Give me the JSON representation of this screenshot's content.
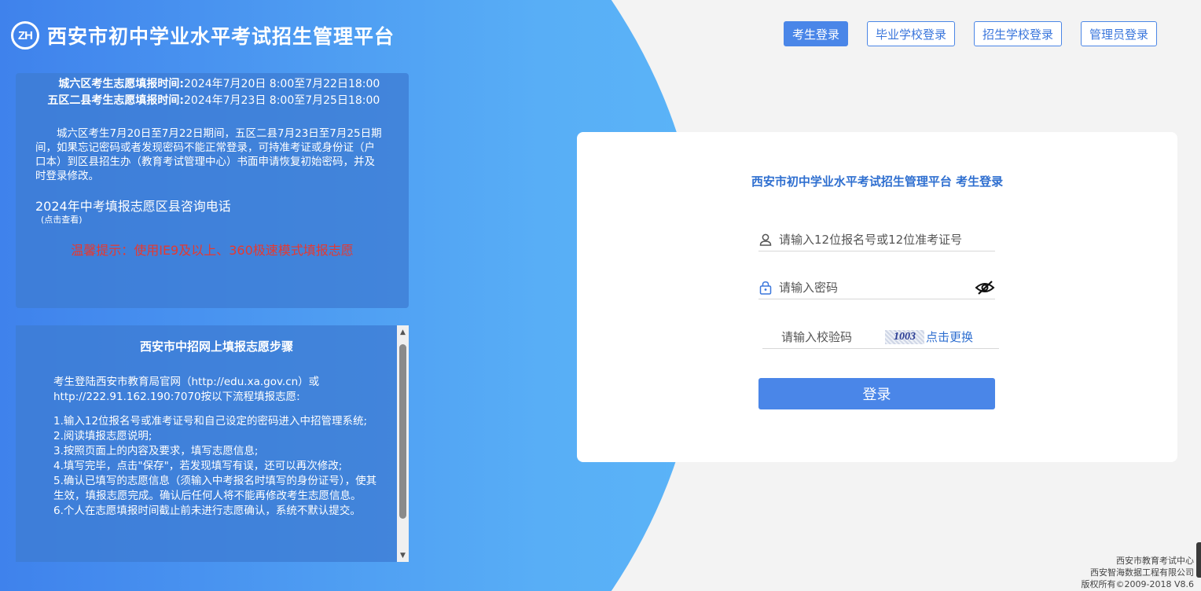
{
  "header": {
    "logo_text": "ZH",
    "title": "西安市初中学业水平考试招生管理平台"
  },
  "nav": {
    "items": [
      {
        "label": "考生登录",
        "active": true
      },
      {
        "label": "毕业学校登录"
      },
      {
        "label": "招生学校登录"
      },
      {
        "label": "管理员登录"
      }
    ]
  },
  "notice": {
    "times": [
      {
        "label": "城六区考生志愿填报时间:",
        "value": "2024年7月20日 8:00至7月22日18:00"
      },
      {
        "label": "五区二县考生志愿填报时间:",
        "value": "2024年7月23日 8:00至7月25日18:00"
      }
    ],
    "paragraph": "城六区考生7月20日至7月22日期间，五区二县7月23日至7月25日期间，如果忘记密码或者发现密码不能正常登录，可持准考证或身份证（户口本）到区县招生办（教育考试管理中心）书面申请恢复初始密码，并及时登录修改。",
    "phone_title": "2024年中考填报志愿区县咨询电话",
    "phone_sub": "(点击查看)",
    "warm_tip": "温馨提示：使用IE9及以上、360极速模式填报志愿"
  },
  "steps": {
    "title": "西安市中招网上填报志愿步骤",
    "intro": "考生登陆西安市教育局官网（http://edu.xa.gov.cn）或http://222.91.162.190:7070按以下流程填报志愿:",
    "items": [
      "1.输入12位报名号或准考证号和自己设定的密码进入中招管理系统;",
      "2.阅读填报志愿说明;",
      "3.按照页面上的内容及要求，填写志愿信息;",
      "4.填写完毕，点击\"保存\"，若发现填写有误，还可以再次修改;",
      "5.确认已填写的志愿信息（须输入中考报名时填写的身份证号），使其生效，填报志愿完成。确认后任何人将不能再修改考生志愿信息。",
      "6.个人在志愿填报时间截止前未进行志愿确认，系统不默认提交。"
    ]
  },
  "login": {
    "title": "西安市初中学业水平考试招生管理平台 考生登录",
    "username_placeholder": "请输入12位报名号或12位准考证号",
    "password_placeholder": "请输入密码",
    "captcha_placeholder": "请输入校验码",
    "captcha_code": "1003",
    "captcha_refresh": "点击更换",
    "submit": "登录"
  },
  "footer": {
    "line1": "西安市教育考试中心",
    "line2": "西安智海数据工程有限公司",
    "line3": "版权所有©2009-2018 V8.6"
  },
  "colors": {
    "accent": "#4a86e8",
    "warning": "#e8382e"
  }
}
